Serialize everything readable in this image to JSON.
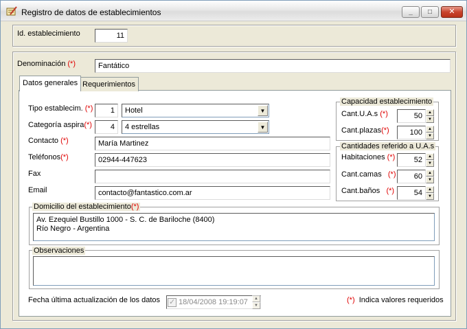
{
  "window": {
    "title": "Registro de datos de establecimientos",
    "controls": {
      "minimize": "_",
      "maximize": "□",
      "close": "✕"
    }
  },
  "establishment_id": {
    "label": "Id. establecimiento",
    "value": "11"
  },
  "denominacion": {
    "label": "Denominación",
    "required_mark": "(*)",
    "value": "Fantático"
  },
  "tabs": [
    {
      "label": "Datos generales",
      "active": true
    },
    {
      "label": "Requerimientos",
      "active": false
    }
  ],
  "general": {
    "tipo": {
      "label": "Tipo establecim.",
      "required_mark": "(*)",
      "code": "1",
      "selected": "Hotel"
    },
    "categoria": {
      "label": "Categoría aspira",
      "required_mark": "(*)",
      "code": "4",
      "selected": "4 estrellas"
    },
    "contacto": {
      "label": "Contacto",
      "required_mark": "(*)",
      "value": "María Martinez"
    },
    "telefonos": {
      "label": "Teléfonos",
      "required_mark": "(*)",
      "value": "02944-447623"
    },
    "fax": {
      "label": "Fax",
      "value": ""
    },
    "email": {
      "label": "Email",
      "value": "contacto@fantastico.com.ar"
    }
  },
  "capacidad": {
    "legend": "Capacidad establecimiento",
    "uas": {
      "label": "Cant.U.A.s",
      "required_mark": "(*)",
      "value": "50"
    },
    "plazas": {
      "label": "Cant.plazas",
      "required_mark": "(*)",
      "value": "100"
    }
  },
  "cantidades": {
    "legend": "Cantidades referido a U.A.s",
    "habitaciones": {
      "label": "Habitaciones",
      "required_mark": "(*)",
      "value": "52"
    },
    "camas": {
      "label": "Cant.camas",
      "required_mark": "(*)",
      "value": "60"
    },
    "banos": {
      "label": "Cant.baños",
      "required_mark": "(*)",
      "value": "54"
    }
  },
  "domicilio": {
    "legend": "Domicilio del establecimiento",
    "required_mark": "(*)",
    "line1": "Av. Ezequiel Bustillo 1000 - S. C. de Bariloche (8400)",
    "line2": "Río Negro - Argentina"
  },
  "observaciones": {
    "legend": "Observaciones",
    "value": ""
  },
  "footer": {
    "fecha_label": "Fecha última actualización de los datos",
    "fecha_value": "18/04/2008 19:19:07",
    "required_mark": "(*)",
    "required_note": "Indica valores requeridos"
  }
}
